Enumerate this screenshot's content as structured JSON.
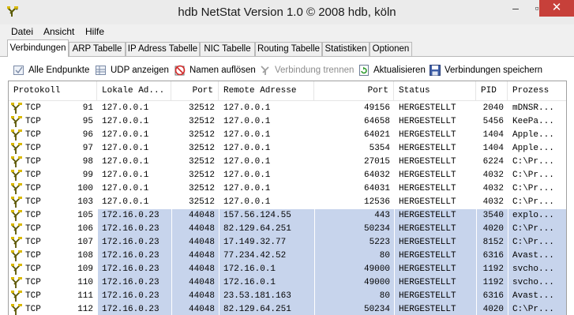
{
  "window": {
    "title": "hdb NetStat Version 1.0  © 2008 hdb, köln",
    "minimize_glyph": "–",
    "maximize_glyph": "▫",
    "close_glyph": "✕"
  },
  "menu": [
    "Datei",
    "Ansicht",
    "Hilfe"
  ],
  "tabs": [
    "Verbindungen",
    "ARP Tabelle",
    "IP Adress Tabelle",
    "NIC Tabelle",
    "Routing Tabelle",
    "Statistiken",
    "Optionen"
  ],
  "toolbar": {
    "all_endpoints": "Alle Endpunkte",
    "show_udp": "UDP anzeigen",
    "resolve_names": "Namen auflösen",
    "disconnect": "Verbindung trennen",
    "refresh": "Aktualisieren",
    "save_connections": "Verbindungen speichern"
  },
  "table": {
    "headers": [
      "Protokoll",
      "Lokale Ad...",
      "Port",
      "Remote Adresse",
      "Port",
      "Status",
      "PID",
      "Prozess"
    ],
    "rows": [
      {
        "proto": "TCP",
        "num": "91",
        "local": "127.0.0.1",
        "lport": "32512",
        "remote": "127.0.0.1",
        "rport": "49156",
        "status": "HERGESTELLT",
        "pid": "2040",
        "proc": "mDNSR..."
      },
      {
        "proto": "TCP",
        "num": "95",
        "local": "127.0.0.1",
        "lport": "32512",
        "remote": "127.0.0.1",
        "rport": "64658",
        "status": "HERGESTELLT",
        "pid": "5456",
        "proc": "KeePa..."
      },
      {
        "proto": "TCP",
        "num": "96",
        "local": "127.0.0.1",
        "lport": "32512",
        "remote": "127.0.0.1",
        "rport": "64021",
        "status": "HERGESTELLT",
        "pid": "1404",
        "proc": "Apple..."
      },
      {
        "proto": "TCP",
        "num": "97",
        "local": "127.0.0.1",
        "lport": "32512",
        "remote": "127.0.0.1",
        "rport": "5354",
        "status": "HERGESTELLT",
        "pid": "1404",
        "proc": "Apple..."
      },
      {
        "proto": "TCP",
        "num": "98",
        "local": "127.0.0.1",
        "lport": "32512",
        "remote": "127.0.0.1",
        "rport": "27015",
        "status": "HERGESTELLT",
        "pid": "6224",
        "proc": "C:\\Pr..."
      },
      {
        "proto": "TCP",
        "num": "99",
        "local": "127.0.0.1",
        "lport": "32512",
        "remote": "127.0.0.1",
        "rport": "64032",
        "status": "HERGESTELLT",
        "pid": "4032",
        "proc": "C:\\Pr..."
      },
      {
        "proto": "TCP",
        "num": "100",
        "local": "127.0.0.1",
        "lport": "32512",
        "remote": "127.0.0.1",
        "rport": "64031",
        "status": "HERGESTELLT",
        "pid": "4032",
        "proc": "C:\\Pr..."
      },
      {
        "proto": "TCP",
        "num": "103",
        "local": "127.0.0.1",
        "lport": "32512",
        "remote": "127.0.0.1",
        "rport": "12536",
        "status": "HERGESTELLT",
        "pid": "4032",
        "proc": "C:\\Pr..."
      },
      {
        "proto": "TCP",
        "num": "105",
        "local": "172.16.0.23",
        "lport": "44048",
        "remote": "157.56.124.55",
        "rport": "443",
        "status": "HERGESTELLT",
        "pid": "3540",
        "proc": "explo...",
        "selected": true
      },
      {
        "proto": "TCP",
        "num": "106",
        "local": "172.16.0.23",
        "lport": "44048",
        "remote": "82.129.64.251",
        "rport": "50234",
        "status": "HERGESTELLT",
        "pid": "4020",
        "proc": "C:\\Pr...",
        "selected": true
      },
      {
        "proto": "TCP",
        "num": "107",
        "local": "172.16.0.23",
        "lport": "44048",
        "remote": "17.149.32.77",
        "rport": "5223",
        "status": "HERGESTELLT",
        "pid": "8152",
        "proc": "C:\\Pr...",
        "selected": true
      },
      {
        "proto": "TCP",
        "num": "108",
        "local": "172.16.0.23",
        "lport": "44048",
        "remote": "77.234.42.52",
        "rport": "80",
        "status": "HERGESTELLT",
        "pid": "6316",
        "proc": "Avast...",
        "selected": true
      },
      {
        "proto": "TCP",
        "num": "109",
        "local": "172.16.0.23",
        "lport": "44048",
        "remote": "172.16.0.1",
        "rport": "49000",
        "status": "HERGESTELLT",
        "pid": "1192",
        "proc": "svcho...",
        "selected": true
      },
      {
        "proto": "TCP",
        "num": "110",
        "local": "172.16.0.23",
        "lport": "44048",
        "remote": "172.16.0.1",
        "rport": "49000",
        "status": "HERGESTELLT",
        "pid": "1192",
        "proc": "svcho...",
        "selected": true
      },
      {
        "proto": "TCP",
        "num": "111",
        "local": "172.16.0.23",
        "lport": "44048",
        "remote": "23.53.181.163",
        "rport": "80",
        "status": "HERGESTELLT",
        "pid": "6316",
        "proc": "Avast...",
        "selected": true
      },
      {
        "proto": "TCP",
        "num": "112",
        "local": "172.16.0.23",
        "lport": "44048",
        "remote": "82.129.64.251",
        "rport": "50234",
        "status": "HERGESTELLT",
        "pid": "4020",
        "proc": "C:\\Pr...",
        "selected": true
      }
    ]
  },
  "colors": {
    "selection": "#c7d4ec",
    "close_button": "#c7403a"
  }
}
